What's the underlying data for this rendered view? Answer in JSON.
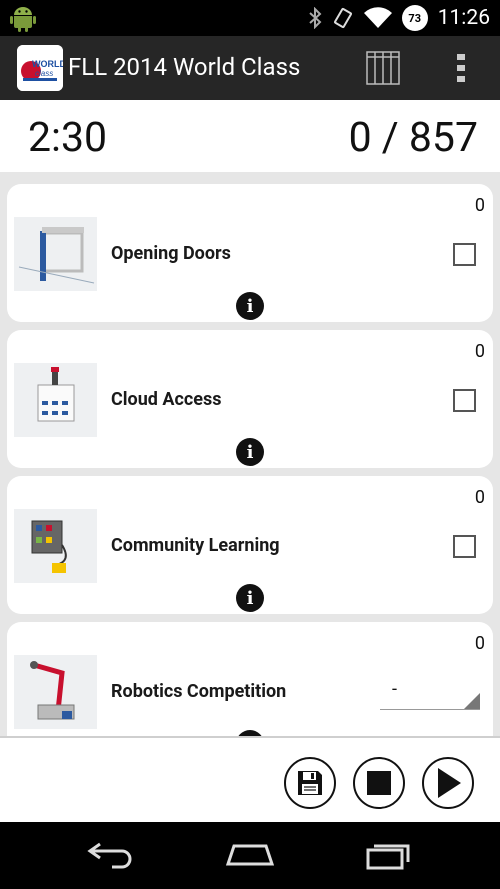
{
  "status_bar": {
    "time": "11:26",
    "battery": "73",
    "icons": [
      "android-icon",
      "bluetooth-icon",
      "vibrate-icon",
      "wifi-icon",
      "battery-icon"
    ]
  },
  "action_bar": {
    "title": "FLL 2014 World Class",
    "logo_text": "WORLD class",
    "icons": [
      "grid-view-icon",
      "overflow-menu-icon"
    ]
  },
  "scorebar": {
    "timer": "2:30",
    "score": "0 / 857"
  },
  "missions": [
    {
      "name": "Opening Doors",
      "points": "0",
      "control": "checkbox",
      "checked": false
    },
    {
      "name": "Cloud Access",
      "points": "0",
      "control": "checkbox",
      "checked": false
    },
    {
      "name": "Community Learning",
      "points": "0",
      "control": "checkbox",
      "checked": false
    },
    {
      "name": "Robotics Competition",
      "points": "0",
      "control": "dropdown",
      "selected": "-"
    }
  ],
  "info_glyph": "i",
  "controls": [
    "save-icon",
    "stop-icon",
    "play-icon"
  ],
  "nav_bar": [
    "back-icon",
    "home-icon",
    "recent-apps-icon"
  ],
  "colors": {
    "action_bar": "#262626",
    "background": "#e6e6e6",
    "card": "#ffffff"
  }
}
